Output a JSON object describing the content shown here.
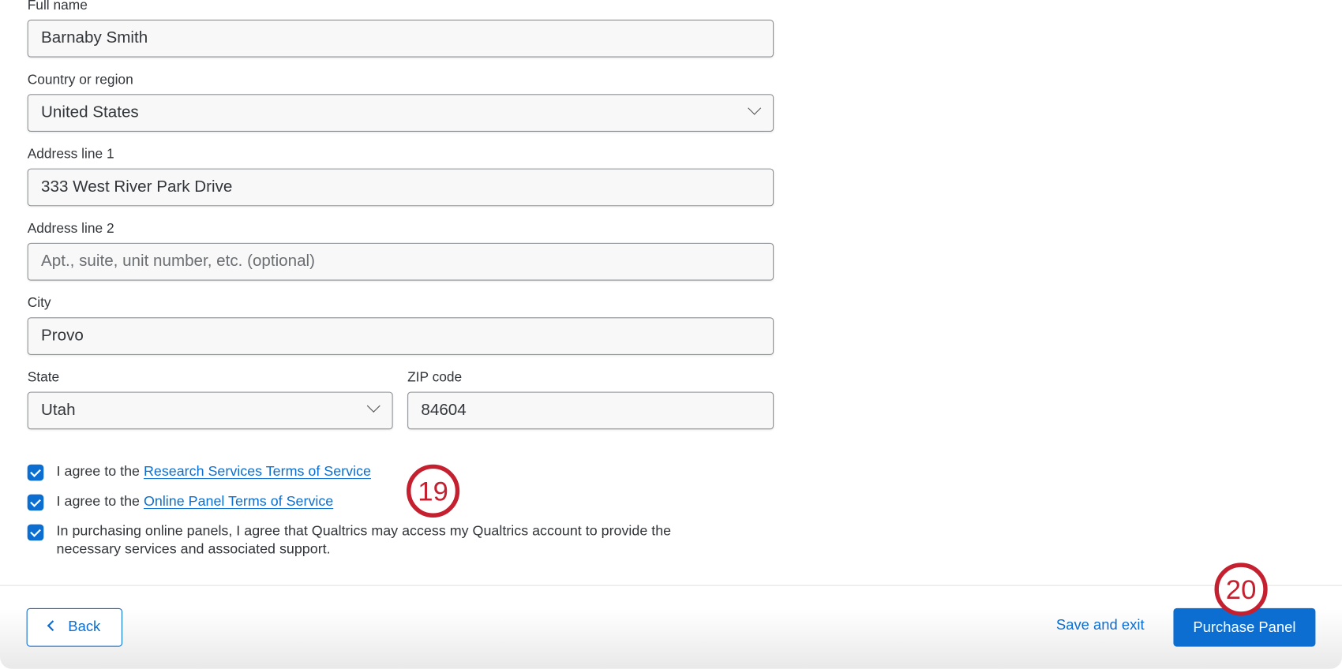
{
  "form": {
    "full_name": {
      "label": "Full name",
      "value": "Barnaby Smith"
    },
    "country": {
      "label": "Country or region",
      "value": "United States"
    },
    "address1": {
      "label": "Address line 1",
      "value": "333 West River Park Drive"
    },
    "address2": {
      "label": "Address line 2",
      "placeholder": "Apt., suite, unit number, etc. (optional)"
    },
    "city": {
      "label": "City",
      "value": "Provo"
    },
    "state": {
      "label": "State",
      "value": "Utah"
    },
    "zip": {
      "label": "ZIP code",
      "value": "84604"
    }
  },
  "agreements": [
    {
      "prefix": "I agree to the ",
      "link": "Research Services Terms of Service",
      "checked": true
    },
    {
      "prefix": "I agree to the ",
      "link": "Online Panel Terms of Service",
      "checked": true
    },
    {
      "text": "In purchasing online panels, I agree that Qualtrics may access my Qualtrics account to provide the necessary services and associated support.",
      "checked": true
    }
  ],
  "footer": {
    "back": "Back",
    "save_exit": "Save and exit",
    "purchase": "Purchase Panel"
  },
  "annotations": {
    "step19": "19",
    "step20": "20"
  },
  "colors": {
    "accent": "#0b6ed0",
    "annotation": "#c4202f"
  }
}
